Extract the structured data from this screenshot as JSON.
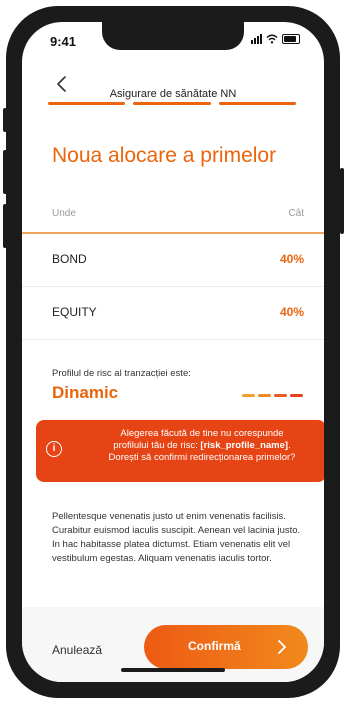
{
  "status_bar": {
    "time": "9:41"
  },
  "header": {
    "title": "Asigurare de sănătate NN",
    "back_icon": "chevron-left-icon"
  },
  "page": {
    "title": "Noua alocare a primelor"
  },
  "table": {
    "col_where": "Unde",
    "col_how_much": "Cât",
    "rows": [
      {
        "name": "BOND",
        "percent": "40%"
      },
      {
        "name": "EQUITY",
        "percent": "40%"
      }
    ]
  },
  "risk": {
    "label": "Profilul de risc al tranzacției este:",
    "profile": "Dinamic",
    "meter_colors": [
      "#f0a030",
      "#ee8a25",
      "#e95c1f",
      "#e6401c"
    ]
  },
  "alert": {
    "icon": "info-icon",
    "line1": "Alegerea făcută de tine nu corespunde",
    "line2_prefix": "profilului tău de risc: ",
    "line2_bold": "[risk_profile_name]",
    "line2_suffix": ".",
    "line3": "Dorești să confirmi redirecționarea primelor?"
  },
  "body_text": "Pellentesque venenatis justo ut enim venenatis facilisis. Curabitur euismod iaculis suscipit. Aenean vel lacinia justo. In hac habitasse platea dictumst. Etiam venenatis elit vel vestibulum egestas. Aliquam venenatis iaculis tortor.",
  "footer": {
    "cancel_label": "Anulează",
    "confirm_label": "Confirmă",
    "confirm_icon": "chevron-right-icon"
  },
  "colors": {
    "accent": "#ea650d",
    "alert": "#e64415"
  }
}
